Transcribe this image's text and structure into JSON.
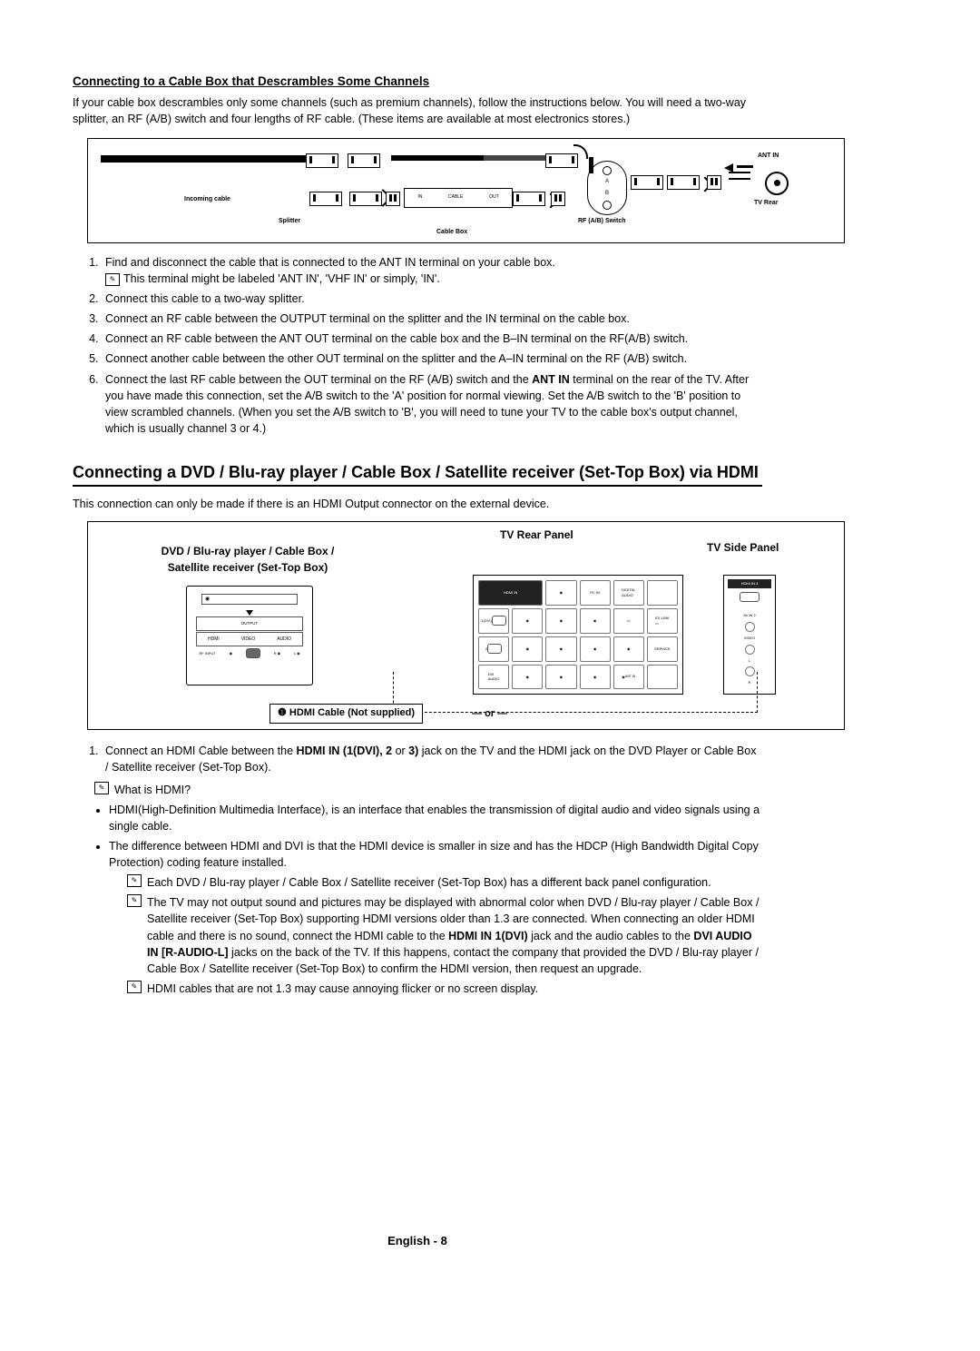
{
  "section1": {
    "title": "Connecting to a Cable Box that Descrambles Some Channels",
    "intro": "If your cable box descrambles only some channels (such as premium channels), follow the instructions below. You will need a two-way splitter, an RF (A/B) switch and four lengths of RF cable. (These items are available at most electronics stores.)",
    "diag": {
      "incoming": "Incoming cable",
      "splitter": "Splitter",
      "cablebox": "Cable Box",
      "in": "IN",
      "cable": "CABLE",
      "out": "OUT",
      "rfswitch": "RF (A/B) Switch",
      "a": "A",
      "b": "B",
      "antin": "ANT IN",
      "tvrear": "TV Rear"
    },
    "step1": "Find and disconnect the cable that is connected to the ANT IN terminal on your cable box.",
    "step1_note": "This terminal might be labeled 'ANT IN', 'VHF IN' or simply, 'IN'.",
    "step2": "Connect this cable to a two-way splitter.",
    "step3": "Connect an RF cable between the OUTPUT terminal on the splitter and the IN terminal on the cable box.",
    "step4": "Connect an RF cable between the ANT OUT terminal on the cable box and the B–IN terminal on the RF(A/B) switch.",
    "step5": "Connect another cable between the other OUT terminal on the splitter and the A–IN terminal on the RF (A/B) switch.",
    "step6_a": "Connect the last RF cable between the OUT terminal on the RF (A/B) switch and the ",
    "step6_b": "ANT IN",
    "step6_c": " terminal on the rear of the TV. After you have made this connection, set the A/B switch to the 'A' position for normal viewing. Set the A/B switch to the 'B' position to view scrambled channels. (When you set the A/B switch to 'B', you will need to tune your TV to the cable box's output channel, which is usually channel 3 or 4.)"
  },
  "section2": {
    "title": "Connecting a DVD / Blu-ray player / Cable Box / Satellite receiver (Set-Top Box) via HDMI",
    "intro": "This connection can only be made if there is an HDMI Output connector on the external device.",
    "label_device": "DVD / Blu-ray player / Cable Box / Satellite receiver (Set-Top Box)",
    "label_tv_rear": "TV Rear Panel",
    "label_tv_side": "TV Side Panel",
    "cable_caption": "❶ HDMI Cable (Not supplied)",
    "or": "or",
    "step1_a": "Connect an HDMI Cable between the ",
    "step1_b": "HDMI IN (1(DVI), 2",
    "step1_c": " or ",
    "step1_d": "3)",
    "step1_e": " jack on the TV and the HDMI jack on the DVD Player or Cable Box / Satellite receiver (Set-Top Box).",
    "what": "What is HDMI?",
    "b1": "HDMI(High-Definition Multimedia Interface), is an interface that enables the transmission of digital audio and video signals using a single cable.",
    "b2": "The difference between HDMI and DVI is that the HDMI device is smaller in size and has the HDCP (High Bandwidth Digital Copy Protection) coding feature installed.",
    "n1": "Each DVD / Blu-ray player / Cable Box / Satellite receiver (Set-Top Box) has a different back panel configuration.",
    "n2_a": "The TV may not output sound and pictures may be displayed with abnormal color when DVD / Blu-ray player / Cable Box / Satellite receiver (Set-Top Box) supporting HDMI versions older than 1.3 are connected. When connecting an older HDMI cable and there is no sound, connect the HDMI cable to the ",
    "n2_b": "HDMI IN 1(DVI)",
    "n2_c": " jack and the audio cables to the ",
    "n2_d": "DVI AUDIO IN [R-AUDIO-L]",
    "n2_e": " jacks on the back of the TV. If this happens, contact the company that provided the DVD / Blu-ray player / Cable Box / Satellite receiver (Set-Top Box) to confirm the HDMI version, then request an upgrade.",
    "n3": "HDMI cables that are not 1.3 may cause annoying flicker or no screen display."
  },
  "device_ports": {
    "output": "OUTPUT",
    "hdmi": "HDMI",
    "video": "VIDEO",
    "audio": "AUDIO",
    "rf": "RF INPUT",
    "r": "R",
    "l": "L"
  },
  "footer": "English - 8"
}
